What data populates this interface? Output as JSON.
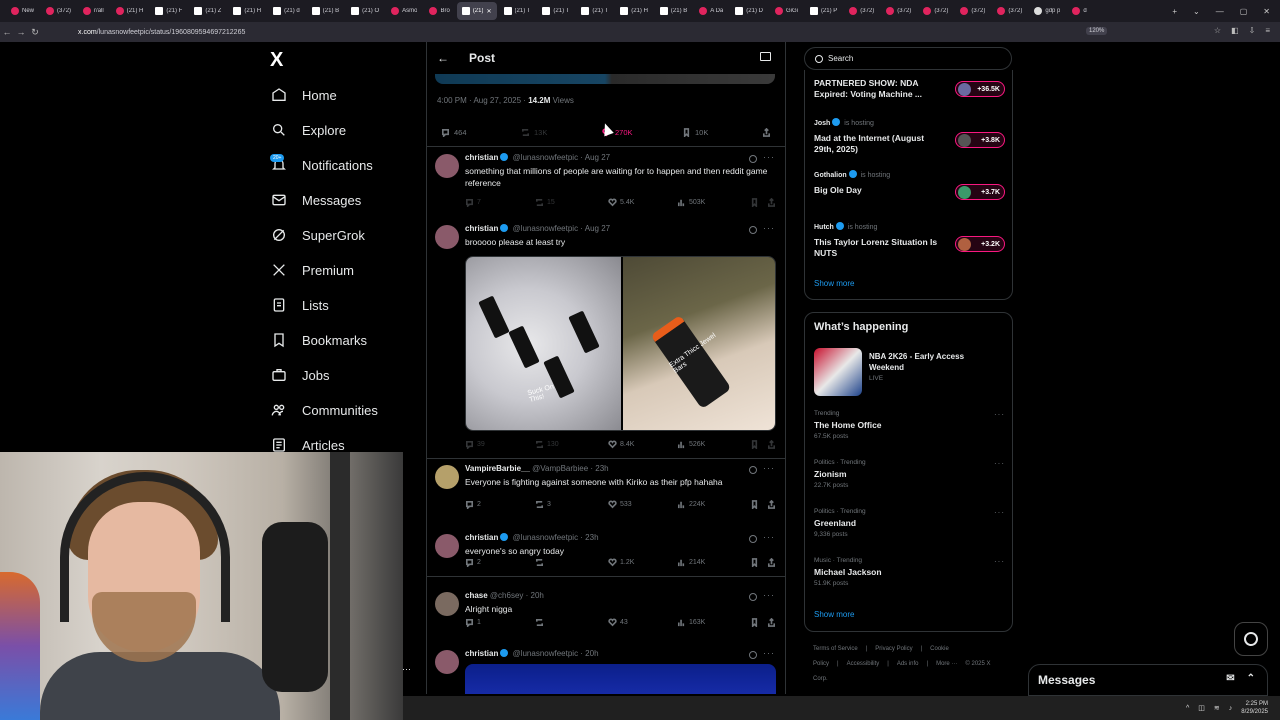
{
  "browser": {
    "tabs": [
      {
        "label": "New"
      },
      {
        "label": "(372)"
      },
      {
        "label": "r/all"
      },
      {
        "label": "(21) H"
      },
      {
        "label": "(21) F"
      },
      {
        "label": "(21) Z"
      },
      {
        "label": "(21) H"
      },
      {
        "label": "(21) d"
      },
      {
        "label": "(21) B"
      },
      {
        "label": "(21) O"
      },
      {
        "label": "Asmo"
      },
      {
        "label": "Bro"
      },
      {
        "label": "(21)"
      },
      {
        "label": "(21) T"
      },
      {
        "label": "(21) T"
      },
      {
        "label": "(21) T"
      },
      {
        "label": "(21) H"
      },
      {
        "label": "(21) B"
      },
      {
        "label": "A Da"
      },
      {
        "label": "(21) D"
      },
      {
        "label": "GiGi"
      },
      {
        "label": "(21) P"
      },
      {
        "label": "(372)"
      },
      {
        "label": "(372)"
      },
      {
        "label": "(372)"
      },
      {
        "label": "(372)"
      },
      {
        "label": "(372)"
      },
      {
        "label": "gdp p"
      },
      {
        "label": "d"
      }
    ],
    "url_domain": "x.com",
    "url_path": "/lunasnowfeetpic/status/1960809594697212265",
    "zoom": "120%"
  },
  "nav": {
    "logo": "X",
    "items": [
      {
        "label": "Home"
      },
      {
        "label": "Explore"
      },
      {
        "label": "Notifications"
      },
      {
        "label": "Messages"
      },
      {
        "label": "SuperGrok"
      },
      {
        "label": "Premium"
      },
      {
        "label": "Lists"
      },
      {
        "label": "Bookmarks"
      },
      {
        "label": "Jobs"
      },
      {
        "label": "Communities"
      },
      {
        "label": "Articles"
      }
    ],
    "notif_badge": "20+"
  },
  "post": {
    "header_title": "Post",
    "time": "4:00 PM · Aug 27, 2025 ·",
    "views": "14.2M",
    "views_label": "Views",
    "stats": {
      "replies": "464",
      "reposts": "13K",
      "likes": "270K",
      "bookmarks": "10K"
    }
  },
  "replies": [
    {
      "name": "christian",
      "handle": "@lunasnowfeetpic · Aug 27",
      "text": "something that millions of people are waiting for to happen and then reddit game reference",
      "replies": "7",
      "reposts": "15",
      "likes": "5.4K",
      "views": "503K"
    },
    {
      "name": "christian",
      "handle": "@lunasnowfeetpic · Aug 27",
      "text": "brooooo please at least try",
      "replies": "39",
      "reposts": "130",
      "likes": "8.4K",
      "views": "526K"
    },
    {
      "name": "VampireBarbie__",
      "handle": "@VampBarbiee · 23h",
      "text": "Everyone is fighting against someone with Kiriko as their pfp hahaha",
      "replies": "2",
      "reposts": "3",
      "likes": "533",
      "views": "224K"
    },
    {
      "name": "christian",
      "handle": "@lunasnowfeetpic · 23h",
      "text": "everyone's so angry today",
      "replies": "2",
      "reposts": "",
      "likes": "1.2K",
      "views": "214K"
    },
    {
      "name": "chase",
      "handle": "@ch6sey · 20h",
      "text": "Alright nigga",
      "replies": "1",
      "reposts": "",
      "likes": "43",
      "views": "163K"
    },
    {
      "name": "christian",
      "handle": "@lunasnowfeetpic · 20h",
      "text": ""
    }
  ],
  "media_text": {
    "left": "Suck On This!",
    "right": "Extra Thicc Jewel Bars"
  },
  "search": {
    "placeholder": "Search"
  },
  "live": [
    {
      "host": "",
      "host_suffix": "",
      "title": "PARTNERED SHOW: NDA Expired: Voting Machine ...",
      "count": "+36.5K"
    },
    {
      "host": "Josh",
      "host_suffix": "is hosting",
      "title": "Mad at the Internet (August 29th, 2025)",
      "count": "+3.8K"
    },
    {
      "host": "Gothalion",
      "host_suffix": "is hosting",
      "title": "Big Ole Day",
      "count": "+3.7K"
    },
    {
      "host": "Hutch",
      "host_suffix": "is hosting",
      "title": "This Taylor Lorenz Situation Is NUTS",
      "count": "+3.2K"
    }
  ],
  "live_show_more": "Show more",
  "whats_happening": {
    "title": "What’s happening",
    "headline": "NBA 2K26 - Early Access Weekend",
    "headline_status": "LIVE",
    "trends": [
      {
        "context": "Trending",
        "name": "The Home Office",
        "count": "67.5K posts"
      },
      {
        "context": "Politics · Trending",
        "name": "Zionism",
        "count": "22.7K posts"
      },
      {
        "context": "Politics · Trending",
        "name": "Greenland",
        "count": "9,336 posts"
      },
      {
        "context": "Music · Trending",
        "name": "Michael Jackson",
        "count": "51.9K posts"
      }
    ],
    "show_more": "Show more"
  },
  "footer": {
    "links": [
      "Terms of Service",
      "|",
      "Privacy Policy",
      "|",
      "Cookie Policy",
      "|",
      "Accessibility",
      "|",
      "Ads info",
      "|",
      "More ···",
      "© 2025 X Corp."
    ]
  },
  "messages_drawer": {
    "title": "Messages"
  },
  "taskbar": {
    "time": "2:25 PM",
    "date": "8/29/2025"
  },
  "colors": {
    "accent": "#1d9bf0",
    "like_pink": "#f91880",
    "bg": "#000000",
    "border": "#2f3336",
    "muted": "#71767b"
  }
}
